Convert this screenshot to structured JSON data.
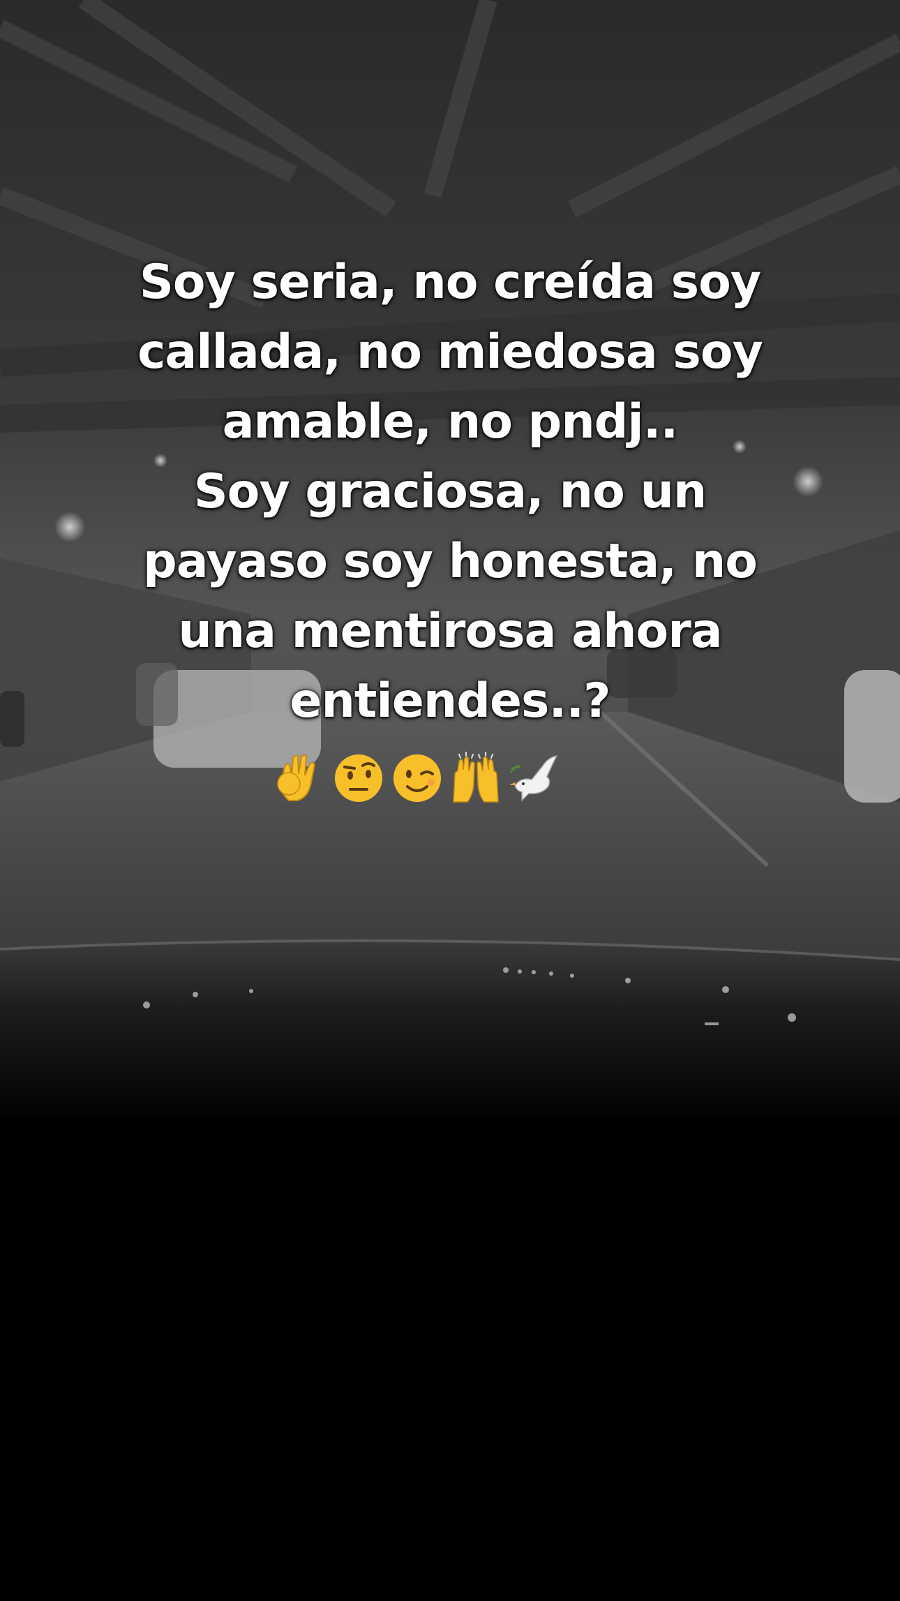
{
  "caption": {
    "lines": [
      "Soy seria, no creída soy",
      "callada, no miedosa soy",
      "amable, no pndj..",
      "Soy graciosa, no un",
      "payaso soy honesta, no",
      "una mentirosa ahora",
      "entiendes..?"
    ]
  },
  "emojis": [
    {
      "name": "ok-hand-icon"
    },
    {
      "name": "raised-eyebrow-face-icon"
    },
    {
      "name": "winking-face-icon"
    },
    {
      "name": "raising-hands-icon"
    },
    {
      "name": "dove-icon"
    }
  ],
  "colors": {
    "background": "#000000",
    "caption_text": "#ffffff",
    "emoji_yellow": "#f7c02b"
  }
}
